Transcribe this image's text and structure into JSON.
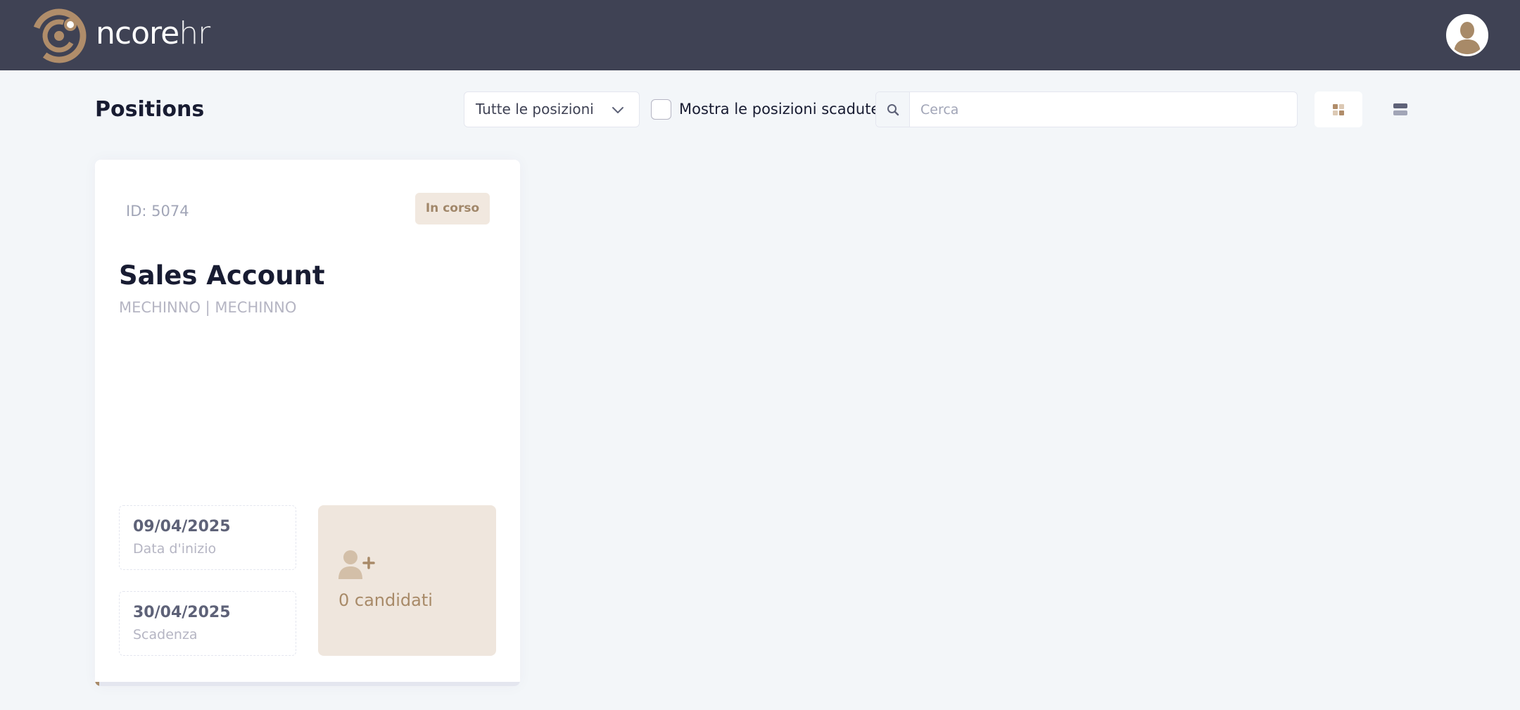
{
  "brand": {
    "name_bold": "ncore",
    "name_light": "hr",
    "accent_color": "#b08d6a",
    "header_bg": "#3f4254"
  },
  "user": {
    "avatar_icon": "user-avatar-icon"
  },
  "toolbar": {
    "title": "Positions",
    "filter_selected": "Tutte le posizioni",
    "show_expired_label": "Mostra le posizioni scadute",
    "show_expired_checked": false,
    "search_placeholder": "Cerca",
    "search_value": ""
  },
  "positions": [
    {
      "id_label": "ID: 5074",
      "status": "In corso",
      "title": "Sales Account",
      "company": "MECHINNO | MECHINNO",
      "start_date": "09/04/2025",
      "start_date_label": "Data d'inizio",
      "deadline": "30/04/2025",
      "deadline_label": "Scadenza",
      "candidates_label": "0 candidati",
      "progress": 0.01
    }
  ]
}
